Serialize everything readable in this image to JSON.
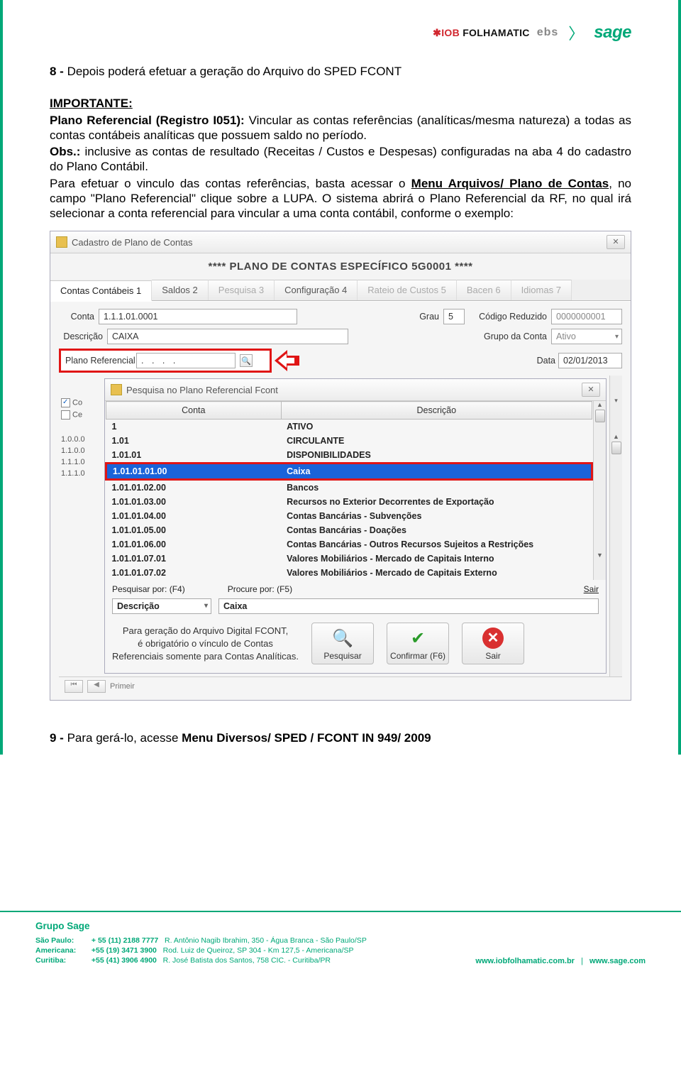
{
  "brand": {
    "iob": "✱IOB",
    "folha": "FOLHAMATIC",
    "ebs": "ebs",
    "sage": "sage"
  },
  "text": {
    "line8_prefix": "8 - ",
    "line8": "Depois poderá efetuar a geração do Arquivo do SPED FCONT",
    "importante": "IMPORTANTE:",
    "plano_bold": "Plano Referencial (Registro I051):",
    "plano_rest": " Vincular as contas referências (analíticas/mesma natureza) a todas as contas contábeis analíticas que possuem saldo no período.",
    "obs": "Obs.:",
    "obs_rest": " inclusive as contas de resultado (Receitas / Custos e Despesas) configuradas na aba 4 do cadastro do Plano Contábil.",
    "para1": "Para efetuar o vinculo das contas referências, basta acessar o ",
    "menu": "Menu Arquivos/ Plano de Contas",
    "para1b": ", no campo \"Plano Referencial\" clique sobre a LUPA. O sistema abrirá o Plano Referencial da RF, no qual irá selecionar a conta referencial para vincular a uma conta contábil, conforme o exemplo:",
    "line9_prefix": "9 - ",
    "line9a": "Para gerá-lo, acesse ",
    "line9b": "Menu Diversos/ SPED / FCONT IN 949/ 2009"
  },
  "win": {
    "title": "Cadastro de Plano de Contas",
    "banner": "**** PLANO DE CONTAS ESPECÍFICO 5G0001 ****",
    "close": "✕",
    "tabs": {
      "t1": "Contas Contábeis 1",
      "t2": "Saldos 2",
      "t3": "Pesquisa 3",
      "t4": "Configuração 4",
      "t5": "Rateio de Custos 5",
      "t6": "Bacen 6",
      "t7": "Idiomas 7"
    },
    "labels": {
      "conta": "Conta",
      "grau": "Grau",
      "codred": "Código Reduzido",
      "descricao": "Descrição",
      "grupo": "Grupo da Conta",
      "planoref": "Plano Referencial",
      "data": "Data"
    },
    "values": {
      "conta": "1.1.1.01.0001",
      "grau": "5",
      "codred": "0000000001",
      "descricao": "CAIXA",
      "grupo": "Ativo",
      "planoref": ". . . .",
      "data": "02/01/2013"
    },
    "nav": {
      "primeir": "Primeir",
      "sair": "Sair"
    },
    "sidechk": {
      "co": "Co",
      "ce": "Ce"
    },
    "sidecodes": [
      "1.0.0.0",
      "1.1.0.0",
      "1.1.1.0",
      "1.1.1.0"
    ]
  },
  "inner": {
    "title": "Pesquisa no Plano Referencial Fcont",
    "close": "✕",
    "headers": {
      "conta": "Conta",
      "descricao": "Descrição"
    },
    "rows": [
      {
        "c": "1",
        "d": "ATIVO"
      },
      {
        "c": "1.01",
        "d": "CIRCULANTE"
      },
      {
        "c": "1.01.01",
        "d": "DISPONIBILIDADES"
      },
      {
        "c": "1.01.01.01.00",
        "d": "Caixa",
        "sel": true
      },
      {
        "c": "1.01.01.02.00",
        "d": "Bancos"
      },
      {
        "c": "1.01.01.03.00",
        "d": "Recursos no Exterior Decorrentes de Exportação"
      },
      {
        "c": "1.01.01.04.00",
        "d": "Contas Bancárias - Subvenções"
      },
      {
        "c": "1.01.01.05.00",
        "d": "Contas Bancárias - Doações"
      },
      {
        "c": "1.01.01.06.00",
        "d": "Contas Bancárias - Outros Recursos Sujeitos a Restrições"
      },
      {
        "c": "1.01.01.07.01",
        "d": "Valores Mobiliários - Mercado de Capitais Interno"
      },
      {
        "c": "1.01.01.07.02",
        "d": "Valores Mobiliários - Mercado de Capitais Externo"
      }
    ],
    "search": {
      "pesqpor": "Pesquisar por: (F4)",
      "procpor": "Procure por: (F5)",
      "combo": "Descrição",
      "value": "Caixa"
    },
    "tip": {
      "l1": "Para geração do Arquivo Digital FCONT,",
      "l2": "é obrigatório o vínculo de Contas",
      "l3": "Referenciais somente para Contas Analíticas."
    },
    "buttons": {
      "pesquisar": "Pesquisar",
      "confirmar": "Confirmar (F6)",
      "sair": "Sair"
    }
  },
  "footer": {
    "grupo": "Grupo Sage",
    "rows": [
      {
        "city": "São Paulo:",
        "ph": "+ 55 (11) 2188 7777",
        "addr": "R. Antônio Nagib Ibrahim, 350 - Água Branca - São Paulo/SP"
      },
      {
        "city": "Americana:",
        "ph": "+55 (19) 3471 3900",
        "addr": "Rod. Luiz de Queiroz, SP 304 - Km 127,5 - Americana/SP"
      },
      {
        "city": "Curitiba:",
        "ph": "+55 (41) 3906 4900",
        "addr": "R. José Batista dos Santos, 758 CIC. - Curitiba/PR"
      }
    ],
    "url1": "www.iobfolhamatic.com.br",
    "sep": "|",
    "url2": "www.sage.com"
  }
}
